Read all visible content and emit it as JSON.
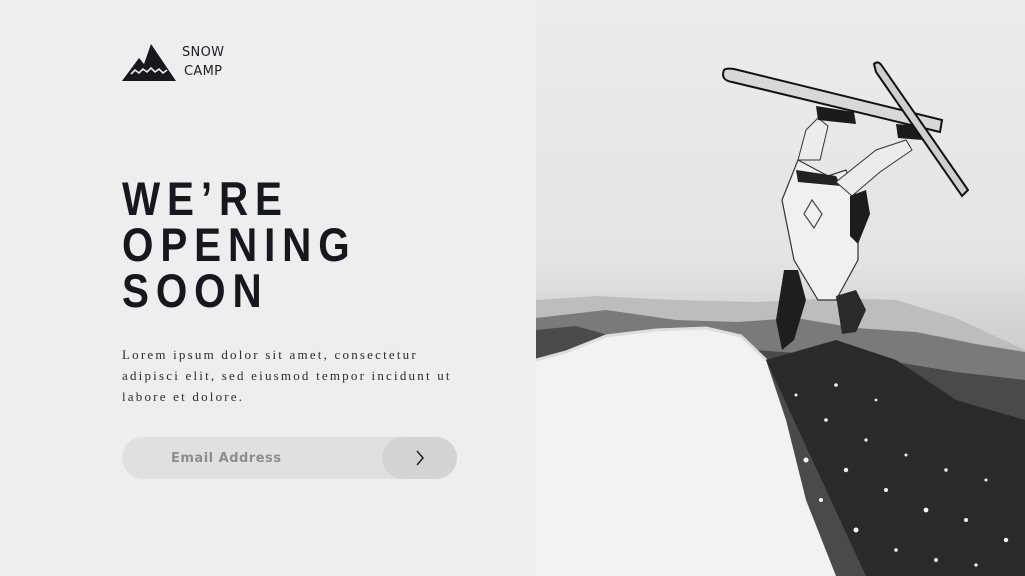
{
  "brand": {
    "line1": "SNOW",
    "line2": "CAMP"
  },
  "hero": {
    "line1": "WE’RE",
    "line2": "OPENING",
    "line3": "SOON"
  },
  "description": "Lorem ipsum dolor sit amet, consectetur adipisci elit, sed eiusmod tempor incidunt ut labore et dolore.",
  "form": {
    "email_placeholder": "Email Address",
    "submit_icon": "chevron-right-icon"
  },
  "photo": {
    "subject": "skier-backflip-icon"
  },
  "colors": {
    "background": "#eeeeee",
    "text": "#16181d",
    "input": "#e0e0e0",
    "button": "#d3d3d3"
  }
}
